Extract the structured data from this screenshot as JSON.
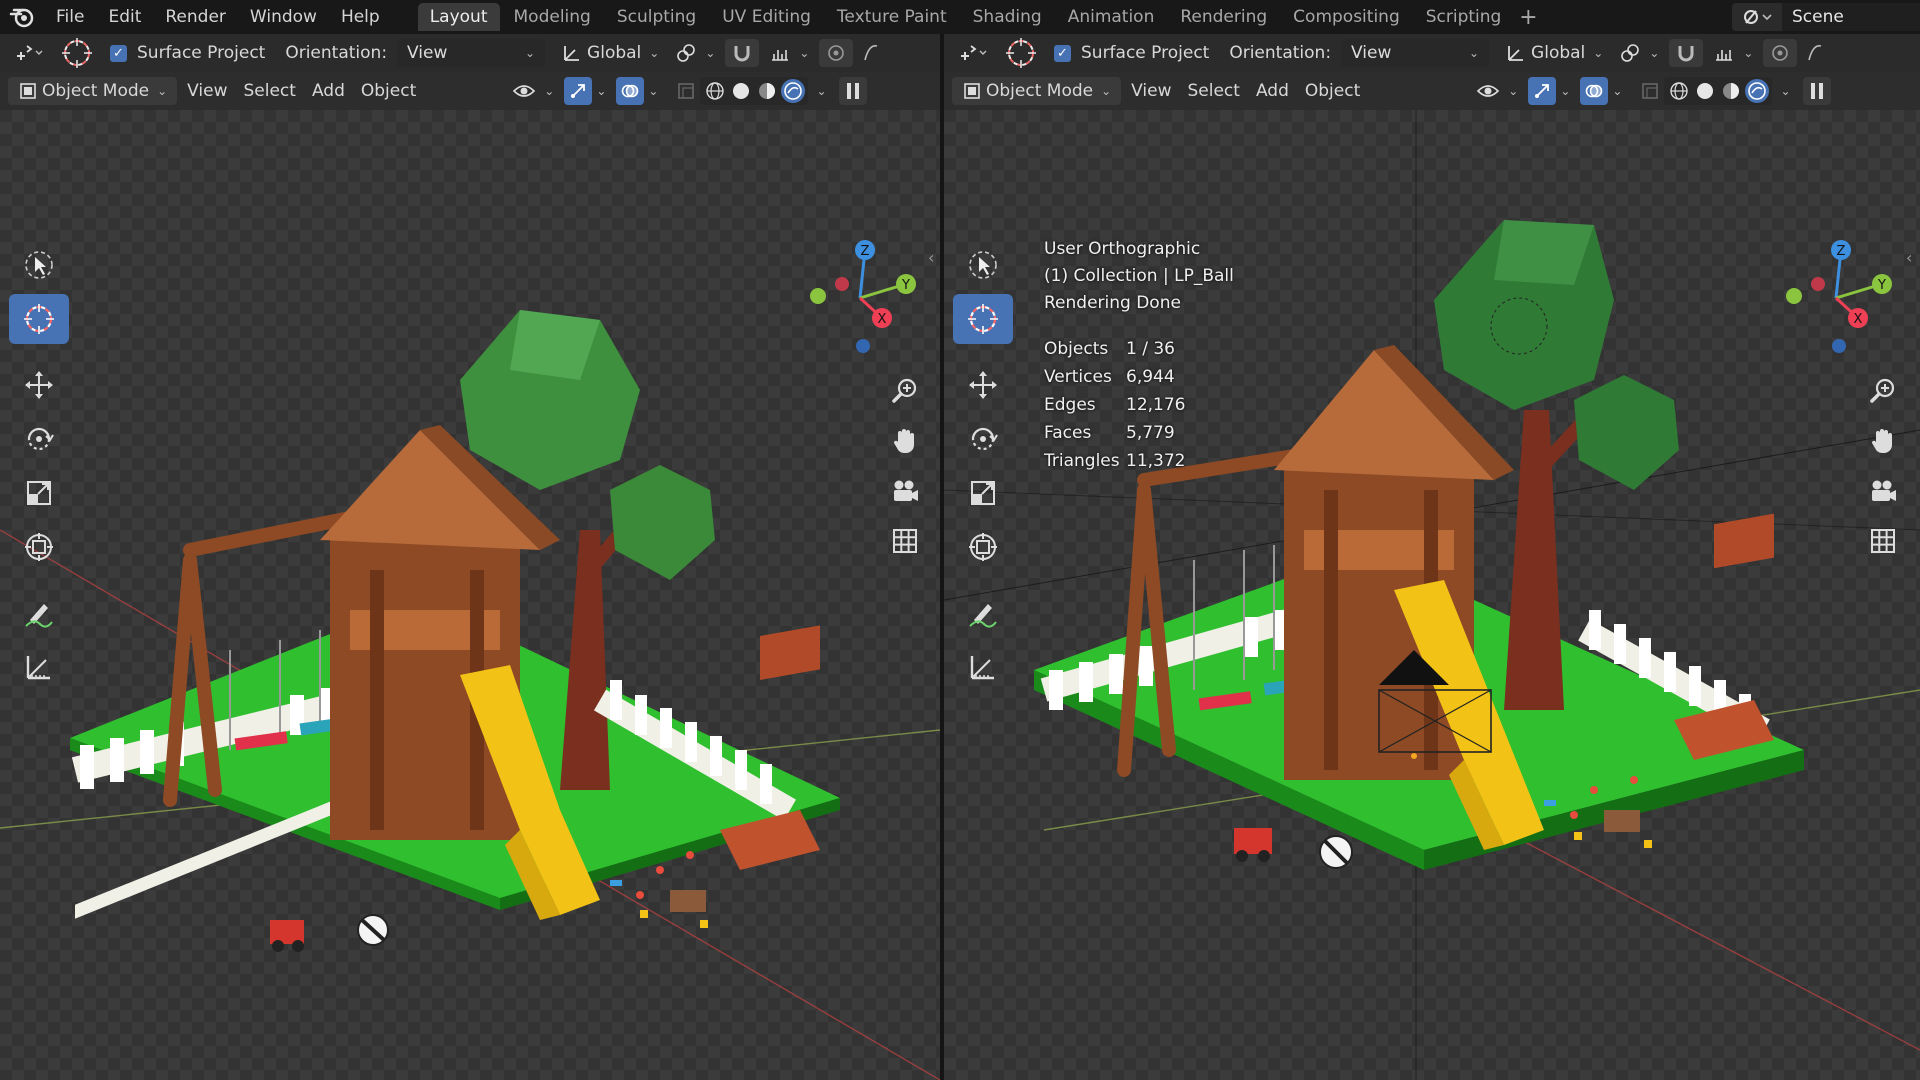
{
  "topbar": {
    "menu": [
      "File",
      "Edit",
      "Render",
      "Window",
      "Help"
    ],
    "workspaces": [
      "Layout",
      "Modeling",
      "Sculpting",
      "UV Editing",
      "Texture Paint",
      "Shading",
      "Animation",
      "Rendering",
      "Compositing",
      "Scripting"
    ],
    "active_workspace": "Layout",
    "scene_name": "Scene"
  },
  "tool_header": {
    "surface_project_label": "Surface Project",
    "surface_project_checked": true,
    "orientation_label": "Orientation:",
    "orientation_value": "View",
    "transform_orientation": "Global"
  },
  "view_header": {
    "mode": "Object Mode",
    "menus": [
      "View",
      "Select",
      "Add",
      "Object"
    ]
  },
  "viewport_right_overlay": {
    "view_name": "User Orthographic",
    "collection": "(1) Collection | LP_Ball",
    "status": "Rendering Done",
    "stats": [
      {
        "label": "Objects",
        "value": "1 / 36"
      },
      {
        "label": "Vertices",
        "value": "6,944"
      },
      {
        "label": "Edges",
        "value": "12,176"
      },
      {
        "label": "Faces",
        "value": "5,779"
      },
      {
        "label": "Triangles",
        "value": "11,372"
      }
    ]
  },
  "gizmo_axes": {
    "x": "X",
    "y": "Y",
    "z": "Z"
  },
  "colors": {
    "accent": "#4772b3",
    "x_axis": "#ee3f55",
    "y_axis": "#8bc53f",
    "z_axis": "#3d8fe0",
    "grass": "#2fbf2f",
    "wood": "#a0522d",
    "roof": "#b76a3a",
    "slide": "#f2c316",
    "foliage": "#3e8f3e"
  }
}
